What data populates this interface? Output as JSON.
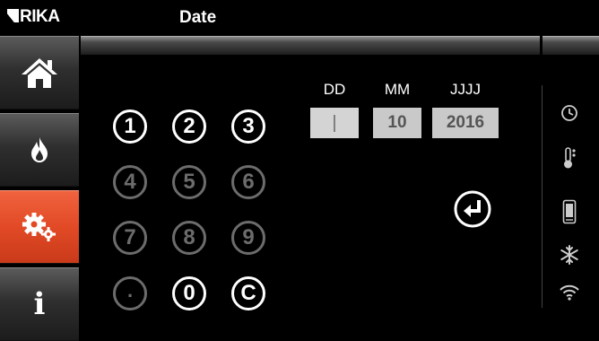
{
  "header": {
    "brand": "RIKA",
    "title": "Date"
  },
  "sidebar": {
    "items": [
      {
        "id": "home",
        "icon": "home-icon"
      },
      {
        "id": "flame",
        "icon": "flame-icon"
      },
      {
        "id": "settings",
        "icon": "gears-icon",
        "active": true
      },
      {
        "id": "info",
        "icon": "info-icon",
        "label": "i"
      }
    ],
    "active_color": "#e24a26"
  },
  "keypad": {
    "keys": [
      {
        "label": "1",
        "enabled": true
      },
      {
        "label": "2",
        "enabled": true
      },
      {
        "label": "3",
        "enabled": true
      },
      {
        "label": "4",
        "enabled": false
      },
      {
        "label": "5",
        "enabled": false
      },
      {
        "label": "6",
        "enabled": false
      },
      {
        "label": "7",
        "enabled": false
      },
      {
        "label": "8",
        "enabled": false
      },
      {
        "label": "9",
        "enabled": false
      },
      {
        "label": ".",
        "enabled": false
      },
      {
        "label": "0",
        "enabled": true
      },
      {
        "label": "C",
        "enabled": true
      }
    ]
  },
  "date": {
    "dd": {
      "label": "DD",
      "value": "|"
    },
    "mm": {
      "label": "MM",
      "value": "10"
    },
    "yyyy": {
      "label": "JJJJ",
      "value": "2016"
    }
  },
  "enter_icon": "enter-icon",
  "status_icons": [
    "clock-icon",
    "thermometer-icon",
    "remote-icon",
    "snowflake-icon",
    "wifi-icon"
  ]
}
